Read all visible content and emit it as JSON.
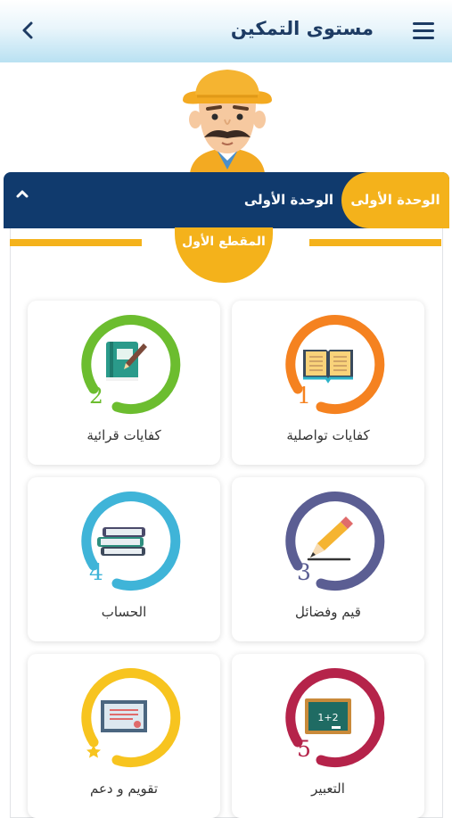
{
  "header": {
    "title": "مستوى التمكين",
    "menu_icon": "hamburger-menu-icon",
    "back_icon": "chevron-left-icon",
    "colors": {
      "title": "#1d3b63",
      "gradient_bottom": "#b9e1f2"
    }
  },
  "unit_bar": {
    "active_tab": "الوحدة الأولى",
    "title": "الوحدة الأولى",
    "collapse_icon": "chevron-up-icon",
    "colors": {
      "background": "#103a6d",
      "pill": "#f4b21b"
    }
  },
  "section": {
    "title": "المقطع الأول"
  },
  "cards": [
    {
      "number": "1",
      "label": "كفايات تواصلية",
      "icon": "open-book-icon",
      "color": "#f58220"
    },
    {
      "number": "2",
      "label": "كفايات قرائية",
      "icon": "book-pen-icon",
      "color": "#6cbd2f"
    },
    {
      "number": "3",
      "label": "قيم وفضائل",
      "icon": "pencil-icon",
      "color": "#5b5e93"
    },
    {
      "number": "4",
      "label": "الحساب",
      "icon": "book-stack-icon",
      "color": "#3fb4d8"
    },
    {
      "number": "5",
      "label": "التعبير",
      "icon": "chalkboard-icon",
      "color": "#b5234a"
    },
    {
      "number": "",
      "label": "تقويم و دعم",
      "icon": "certificate-star-icon",
      "color": "#f7c41f"
    }
  ]
}
